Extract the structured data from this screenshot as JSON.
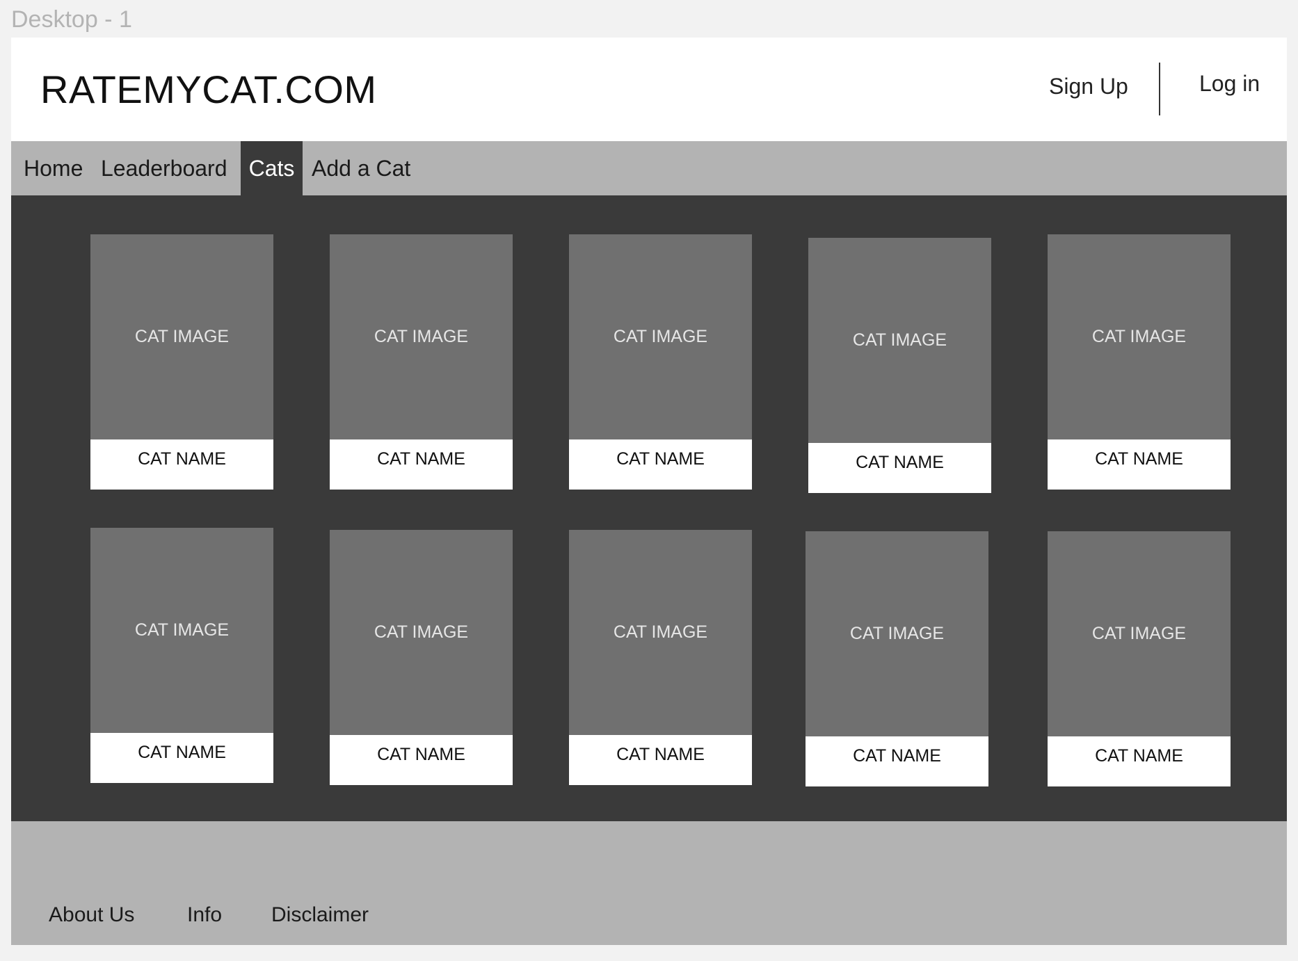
{
  "frame": {
    "label": "Desktop - 1"
  },
  "header": {
    "logo": "RATEMYCAT.COM",
    "sign_up": "Sign Up",
    "log_in": "Log in"
  },
  "nav": {
    "items": [
      {
        "label": "Home"
      },
      {
        "label": "Leaderboard"
      },
      {
        "label": "Cats",
        "active": true
      },
      {
        "label": "Add a Cat"
      }
    ]
  },
  "cats": [
    {
      "image_label": "CAT IMAGE",
      "name": "CAT NAME"
    },
    {
      "image_label": "CAT IMAGE",
      "name": "CAT NAME"
    },
    {
      "image_label": "CAT IMAGE",
      "name": "CAT NAME"
    },
    {
      "image_label": "CAT IMAGE",
      "name": "CAT NAME"
    },
    {
      "image_label": "CAT IMAGE",
      "name": "CAT NAME"
    },
    {
      "image_label": "CAT IMAGE",
      "name": "CAT NAME"
    },
    {
      "image_label": "CAT IMAGE",
      "name": "CAT NAME"
    },
    {
      "image_label": "CAT IMAGE",
      "name": "CAT NAME"
    },
    {
      "image_label": "CAT IMAGE",
      "name": "CAT NAME"
    },
    {
      "image_label": "CAT IMAGE",
      "name": "CAT NAME"
    }
  ],
  "footer": {
    "links": [
      {
        "label": "About Us"
      },
      {
        "label": "Info"
      },
      {
        "label": "Disclaimer"
      }
    ]
  },
  "colors": {
    "canvas": "#f2f2f2",
    "header_bg": "#ffffff",
    "nav_bg": "#b3b3b3",
    "nav_active_bg": "#3a3a3a",
    "content_bg": "#3a3a3a",
    "card_image_bg": "#707070",
    "card_name_bg": "#ffffff",
    "footer_bg": "#b3b3b3"
  }
}
